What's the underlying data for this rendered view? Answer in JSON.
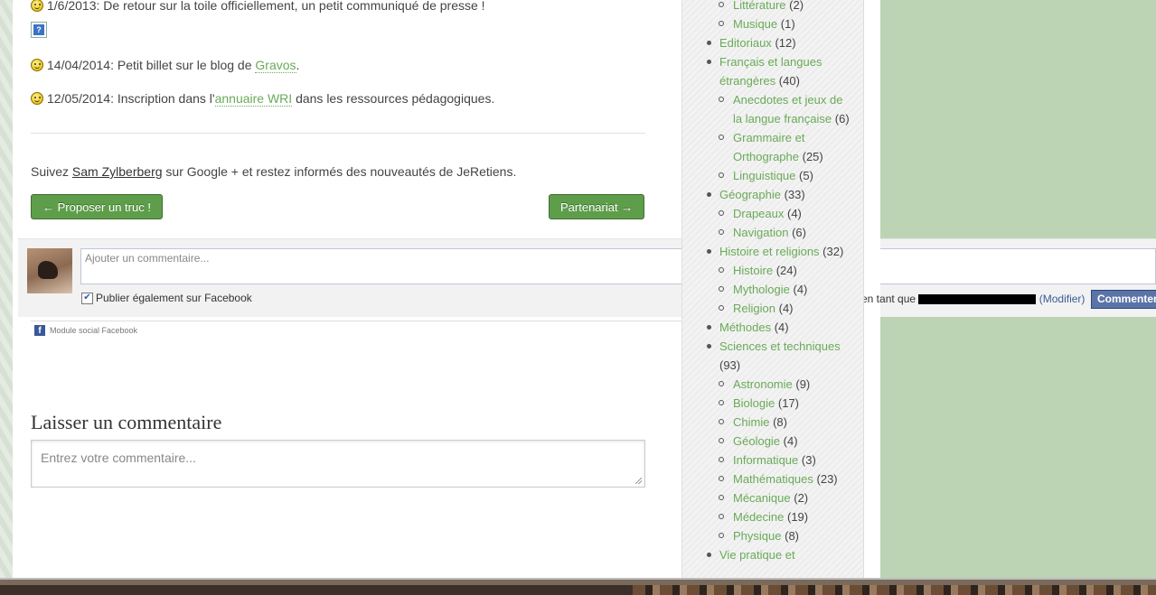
{
  "news": [
    {
      "date": "1/6/2013:",
      "text_before": " De retour sur la toile officiellement, un petit communiqué de presse !",
      "link": "",
      "text_after": ""
    },
    {
      "date": "14/04/2014:",
      "text_before": " Petit billet sur le blog de ",
      "link": "Gravos",
      "text_after": "."
    },
    {
      "date": "12/05/2014:",
      "text_before": " Inscription dans l'",
      "link": "annuaire WRI",
      "text_after": " dans les ressources pédagogiques."
    }
  ],
  "broken_image_glyph": "?",
  "follow": {
    "before": "Suivez ",
    "link": "Sam Zylberberg",
    "after": " sur Google + et restez informés des nouveautés de JeRetiens."
  },
  "nav": {
    "prev": "← Proposer un truc !",
    "next": "Partenariat →"
  },
  "facebook": {
    "placeholder": "Ajouter un commentaire...",
    "checkbox_label": "Publier également sur Facebook",
    "posting_as_prefix": "en tant que",
    "modify": "(Modifier)",
    "submit": "Commenter",
    "social_plugin": "Module social Facebook",
    "logo": "f"
  },
  "leave_comment": {
    "title": "Laisser un commentaire",
    "placeholder": "Entrez votre commentaire..."
  },
  "categories": [
    {
      "level": 2,
      "name": "Littérature",
      "count": "(2)"
    },
    {
      "level": 2,
      "name": "Musique",
      "count": "(1)"
    },
    {
      "level": 1,
      "name": "Editoriaux",
      "count": "(12)"
    },
    {
      "level": 1,
      "name": "Français et langues étrangères",
      "count": "(40)"
    },
    {
      "level": 2,
      "name": "Anecdotes et jeux de la langue française",
      "count": "(6)"
    },
    {
      "level": 2,
      "name": "Grammaire et Orthographe",
      "count": "(25)"
    },
    {
      "level": 2,
      "name": "Linguistique",
      "count": "(5)"
    },
    {
      "level": 1,
      "name": "Géographie",
      "count": "(33)"
    },
    {
      "level": 2,
      "name": "Drapeaux",
      "count": "(4)"
    },
    {
      "level": 2,
      "name": "Navigation",
      "count": "(6)"
    },
    {
      "level": 1,
      "name": "Histoire et religions",
      "count": "(32)"
    },
    {
      "level": 2,
      "name": "Histoire",
      "count": "(24)"
    },
    {
      "level": 2,
      "name": "Mythologie",
      "count": "(4)"
    },
    {
      "level": 2,
      "name": "Religion",
      "count": "(4)"
    },
    {
      "level": 1,
      "name": "Méthodes",
      "count": "(4)"
    },
    {
      "level": 1,
      "name": "Sciences et techniques",
      "count": "(93)"
    },
    {
      "level": 2,
      "name": "Astronomie",
      "count": "(9)"
    },
    {
      "level": 2,
      "name": "Biologie",
      "count": "(17)"
    },
    {
      "level": 2,
      "name": "Chimie",
      "count": "(8)"
    },
    {
      "level": 2,
      "name": "Géologie",
      "count": "(4)"
    },
    {
      "level": 2,
      "name": "Informatique",
      "count": "(3)"
    },
    {
      "level": 2,
      "name": "Mathématiques",
      "count": "(23)"
    },
    {
      "level": 2,
      "name": "Mécanique",
      "count": "(2)"
    },
    {
      "level": 2,
      "name": "Médecine",
      "count": "(19)"
    },
    {
      "level": 2,
      "name": "Physique",
      "count": "(8)"
    },
    {
      "level": 1,
      "name": "Vie pratique et",
      "count": ""
    }
  ],
  "colors": {
    "link_green": "#6aaa58",
    "button_green": "#5e9e4b",
    "facebook_blue": "#3b5998",
    "page_bg": "#bcd4b4"
  }
}
